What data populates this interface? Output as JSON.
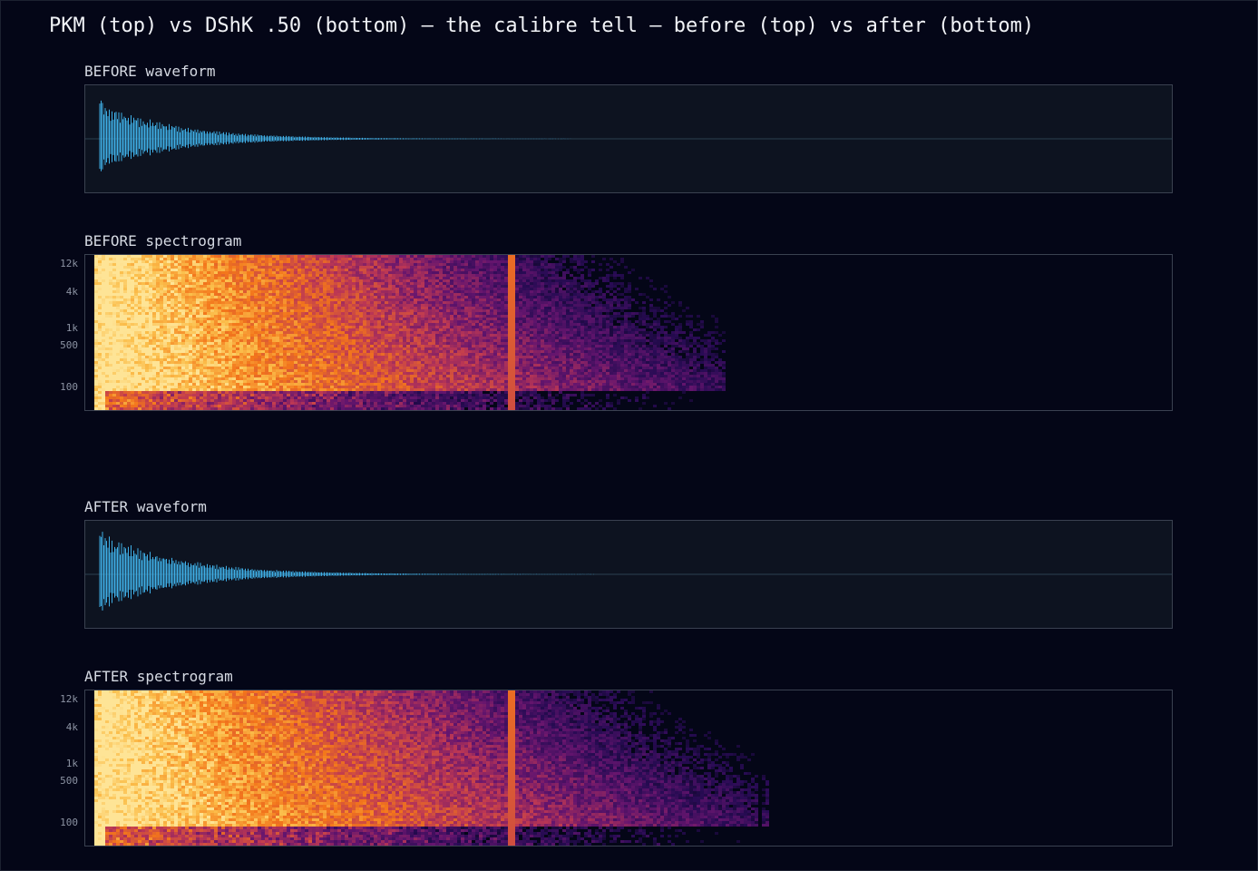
{
  "title": "PKM (top) vs DShK .50 (bottom) — the calibre tell — before (top) vs after (bottom)",
  "colors": {
    "background": "#040617",
    "panel": "#0d1320",
    "border": "#3a4150",
    "waveform": "#3fb0e8",
    "centerline": "#2a4050"
  },
  "chart_data": [
    {
      "type": "line",
      "label": "BEFORE waveform",
      "x_range": [
        0,
        1
      ],
      "y_range": [
        -1,
        1
      ],
      "peak_amplitude": 0.78,
      "decay_end": 0.4,
      "color": "#3fb0e8"
    },
    {
      "type": "heatmap",
      "label": "BEFORE spectrogram",
      "y_ticks": [
        "12k",
        "4k",
        "1k",
        "500",
        "100"
      ],
      "y_scale": "log",
      "energy_end": 0.6,
      "transient_at": 0.39,
      "colormap": "inferno"
    },
    {
      "type": "line",
      "label": "AFTER waveform",
      "x_range": [
        0,
        1
      ],
      "y_range": [
        -1,
        1
      ],
      "peak_amplitude": 0.9,
      "decay_end": 0.42,
      "color": "#3fb0e8"
    },
    {
      "type": "heatmap",
      "label": "AFTER spectrogram",
      "y_ticks": [
        "12k",
        "4k",
        "1k",
        "500",
        "100"
      ],
      "y_scale": "log",
      "energy_end": 0.633,
      "transient_at": 0.39,
      "colormap": "inferno"
    }
  ]
}
